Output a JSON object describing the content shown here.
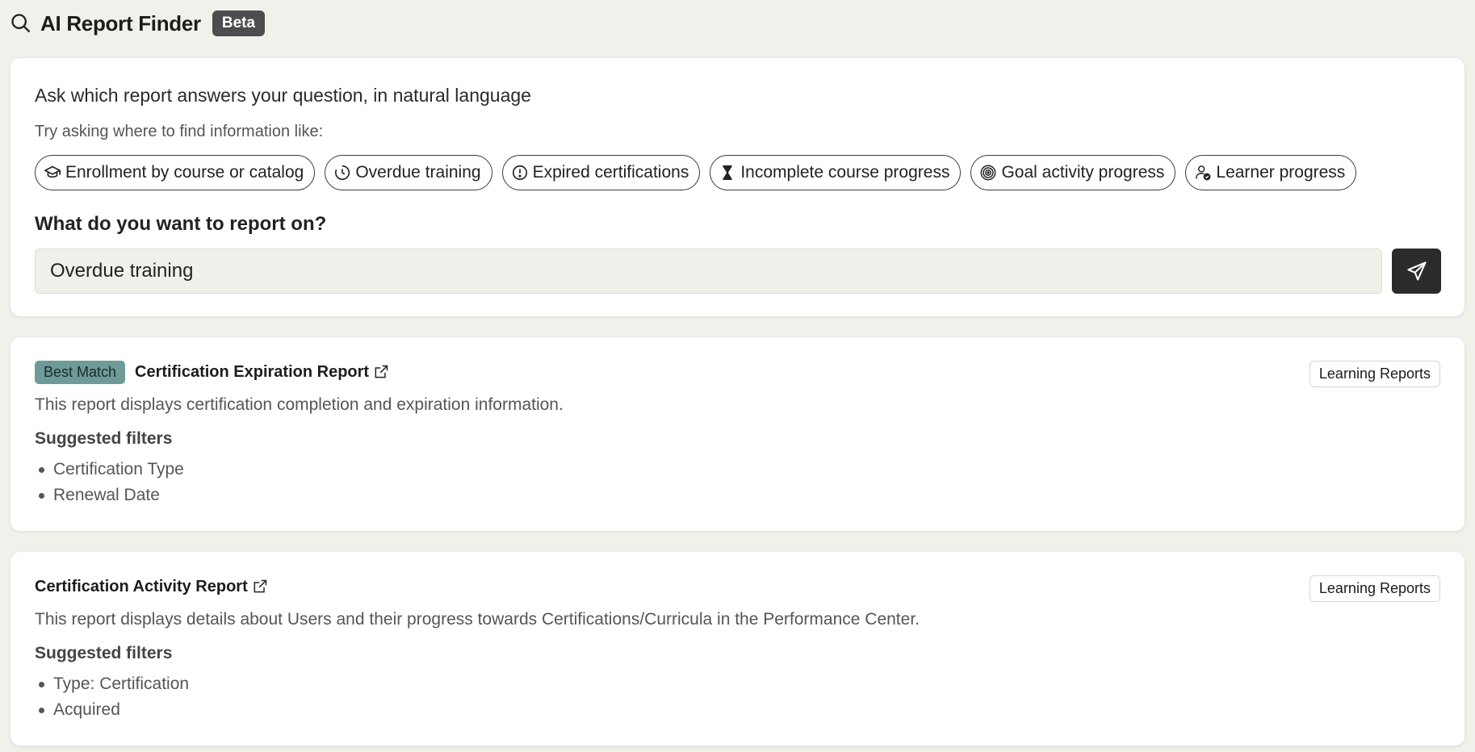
{
  "header": {
    "title": "AI Report Finder",
    "badge": "Beta",
    "icon": "search-icon"
  },
  "query_card": {
    "prompt_title": "Ask which report answers your question, in natural language",
    "hint": "Try asking where to find information like:",
    "suggestions": [
      {
        "label": "Enrollment by course or catalog",
        "icon": "graduation-cap-icon"
      },
      {
        "label": "Overdue training",
        "icon": "clock-icon"
      },
      {
        "label": "Expired certifications",
        "icon": "alert-circle-icon"
      },
      {
        "label": "Incomplete course progress",
        "icon": "hourglass-icon"
      },
      {
        "label": "Goal activity progress",
        "icon": "target-icon"
      },
      {
        "label": "Learner progress",
        "icon": "user-check-icon"
      }
    ],
    "question_label": "What do you want to report on?",
    "input_value": "Overdue training",
    "send_icon": "send-icon"
  },
  "results": [
    {
      "badge": "Best Match",
      "title": "Certification Expiration Report",
      "category": "Learning Reports",
      "description": "This report displays certification completion and expiration information.",
      "filters_title": "Suggested filters",
      "filters": [
        "Certification Type",
        "Renewal Date"
      ]
    },
    {
      "title": "Certification Activity Report",
      "category": "Learning Reports",
      "description": "This report displays details about Users and their progress towards Certifications/Curricula in the Performance Center.",
      "filters_title": "Suggested filters",
      "filters": [
        "Type: Certification",
        "Acquired"
      ]
    }
  ],
  "colors": {
    "page_bg": "#f1f1ec",
    "best_match_bg": "#6e9b98",
    "send_button_bg": "#2b2b2b",
    "beta_badge_bg": "#4d4d4d"
  }
}
